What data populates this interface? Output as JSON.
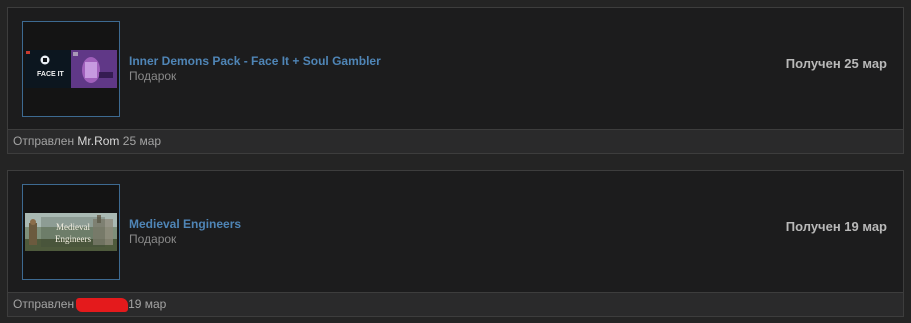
{
  "gifts": [
    {
      "title": "Inner Demons Pack - Face It + Soul Gambler",
      "type": "Подарок",
      "received": "Получен 25 мар",
      "sent_prefix": "Отправлен",
      "sender": "Mr.Rom",
      "sent_date": "25 мар",
      "thumb_text": "FACE IT"
    },
    {
      "title": "Medieval Engineers",
      "type": "Подарок",
      "received": "Получен 19 мар",
      "sent_prefix": "Отправлен",
      "sender_redacted": true,
      "sent_date": "19 мар",
      "thumb_text_1": "Medieval",
      "thumb_text_2": "Engineers"
    }
  ],
  "colors": {
    "link": "#4f85b6",
    "redaction": "#e41a1c",
    "thumb_border": "#3d6a91"
  }
}
